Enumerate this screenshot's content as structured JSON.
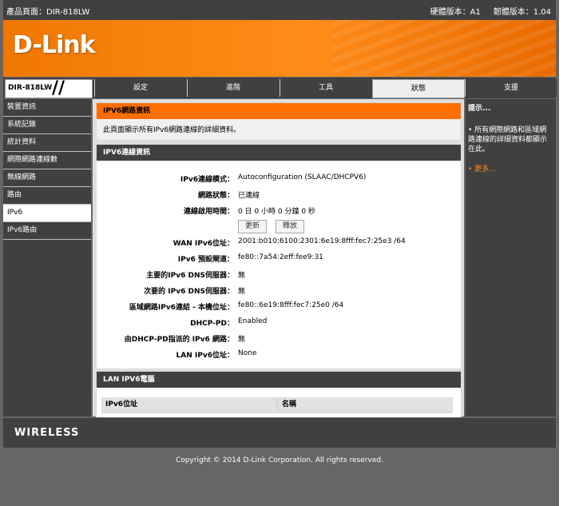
{
  "topbar": {
    "product_label": "產品頁面：DIR-818LW",
    "hw_version": "硬體版本：A1",
    "fw_version": "韌體版本：1.04"
  },
  "brand": {
    "logo_text": "D-Link",
    "wireless_text": "WIRELESS"
  },
  "nav": {
    "model": "DIR-818LW",
    "tabs": [
      {
        "label": "設定"
      },
      {
        "label": "進階"
      },
      {
        "label": "工具"
      },
      {
        "label": "狀態"
      },
      {
        "label": "支援"
      }
    ],
    "active_tab": "狀態"
  },
  "sidebar": {
    "items": [
      {
        "label": "裝置資訊"
      },
      {
        "label": "系統記錄"
      },
      {
        "label": "統計資料"
      },
      {
        "label": "網際網路連線數"
      },
      {
        "label": "無線網路"
      },
      {
        "label": "路由"
      },
      {
        "label": "IPv6"
      },
      {
        "label": "IPv6路由"
      }
    ],
    "active_item": "IPv6"
  },
  "ipv6_network_info": {
    "title": "IPV6網路資訊",
    "description": "此頁面顯示所有IPv6網路連線的詳細資料。"
  },
  "ipv6_connection": {
    "title": "IPV6連線資訊",
    "rows": [
      {
        "label": "IPv6連線模式：",
        "value": "Autoconfiguration (SLAAC/DHCPV6)"
      },
      {
        "label": "網路狀態：",
        "value": "已連線"
      },
      {
        "label": "連線啟用時間：",
        "value": "0 日 0 小時 0 分鐘 0 秒"
      }
    ],
    "buttons": {
      "refresh": "更新",
      "release": "釋放"
    },
    "rows2": [
      {
        "label": "WAN IPv6位址：",
        "value": "2001:b010:6100:2301:6e19:8fff:fec7:25e3 /64"
      },
      {
        "label": "IPv6 預設閘道：",
        "value": "fe80::7a54:2eff:fee9:31"
      },
      {
        "label": "主要的IPv6 DNS伺服器：",
        "value": "無"
      },
      {
        "label": "次要的 IPv6 DNS伺服器：",
        "value": "無"
      },
      {
        "label": "區域網路IPv6連結 - 本機位址：",
        "value": "fe80::6e19:8fff:fec7:25e0 /64"
      },
      {
        "label": "DHCP-PD：",
        "value": "Enabled"
      },
      {
        "label": "由DHCP-PD指派的 IPv6 網路：",
        "value": "無"
      },
      {
        "label": "LAN IPv6位址：",
        "value": "None"
      }
    ]
  },
  "lan_ipv6_computers": {
    "title": "LAN IPV6電腦",
    "columns": [
      "IPv6位址",
      "名稱"
    ]
  },
  "help": {
    "title": "提示...",
    "tip": "• 所有網際網路和區域網路連線的詳細資料都顯示在此。",
    "more": "• 更多..."
  },
  "footer": {
    "copyright": "Copyright © 2014 D-Link Corporation. All rights reserved."
  },
  "colors": {
    "accent_orange": "#ff6f00",
    "dark_gray": "#404040",
    "link_orange": "#ff8a1f"
  }
}
